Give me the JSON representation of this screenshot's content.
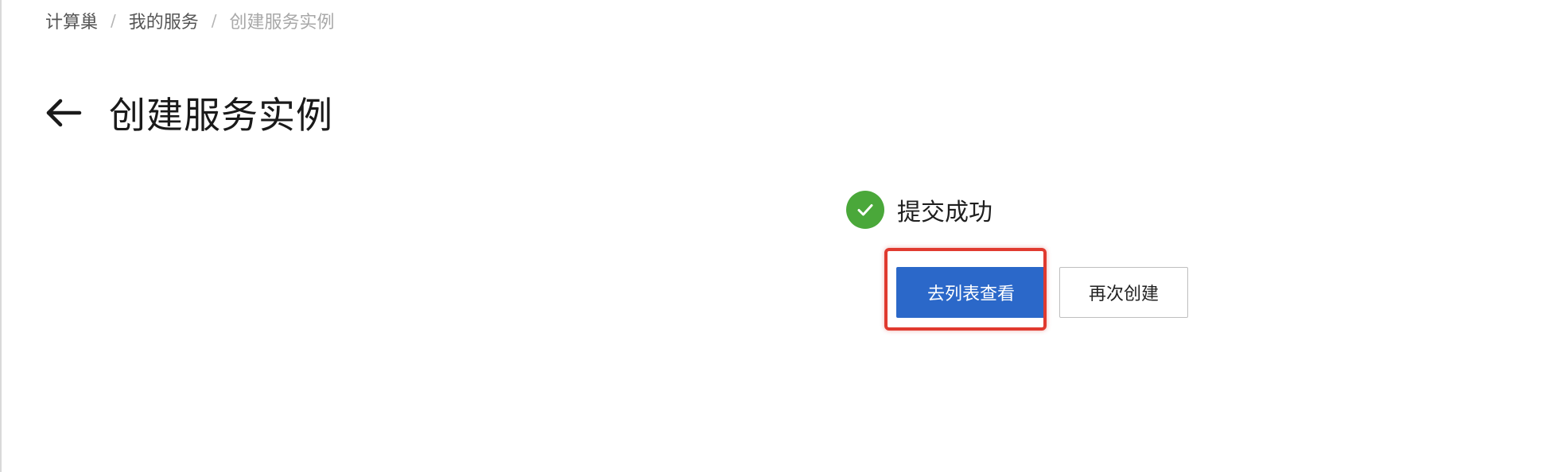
{
  "breadcrumb": {
    "items": [
      "计算巢",
      "我的服务",
      "创建服务实例"
    ],
    "separator": "/"
  },
  "header": {
    "back_icon": "arrow-left-icon",
    "title": "创建服务实例"
  },
  "result": {
    "status_icon": "check-circle-icon",
    "status_text": "提交成功",
    "primary_button_label": "去列表查看",
    "secondary_button_label": "再次创建"
  },
  "colors": {
    "primary": "#2b68c9",
    "success": "#4aa83a",
    "highlight_border": "#e03a2f"
  }
}
